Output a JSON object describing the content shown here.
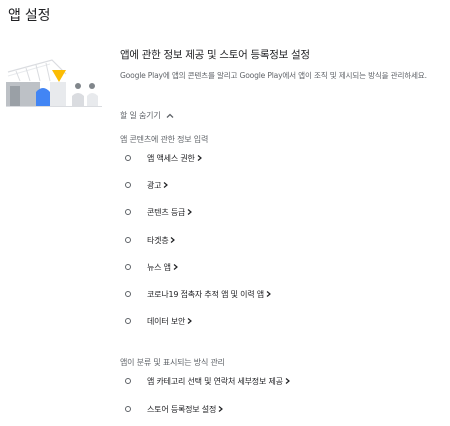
{
  "page": {
    "title": "앱 설정"
  },
  "setup": {
    "heading": "앱에 관한 정보 제공 및 스토어 등록정보 설정",
    "description": "Google Play에 앱의 콘텐츠를 알리고 Google Play에서 앱이 조직 및 제시되는 방식을 관리하세요.",
    "toggle_label": "할 일 숨기기"
  },
  "groups": [
    {
      "label": "앱 콘텐츠에 관한 정보 입력",
      "items": [
        {
          "label": "앱 액세스 권한"
        },
        {
          "label": "광고"
        },
        {
          "label": "콘텐츠 등급"
        },
        {
          "label": "타겟층"
        },
        {
          "label": "뉴스 앱"
        },
        {
          "label": "코로나19 접촉자 추적 앱 및 이력 앱"
        },
        {
          "label": "데이터 보안"
        }
      ]
    },
    {
      "label": "앱이 분류 및 표시되는 방식 관리",
      "items": [
        {
          "label": "앱 카테고리 선택 및 연락처 세부정보 제공"
        },
        {
          "label": "스토어 등록정보 설정"
        }
      ]
    }
  ],
  "icons": {
    "toggle": "chevron-up-icon",
    "item_arrow": "chevron-right-icon",
    "illustration": "app-setup-illustration"
  },
  "colors": {
    "text_primary": "#202124",
    "text_secondary": "#5f6368",
    "accent_blue": "#4285f4",
    "accent_yellow": "#fbbc04"
  }
}
